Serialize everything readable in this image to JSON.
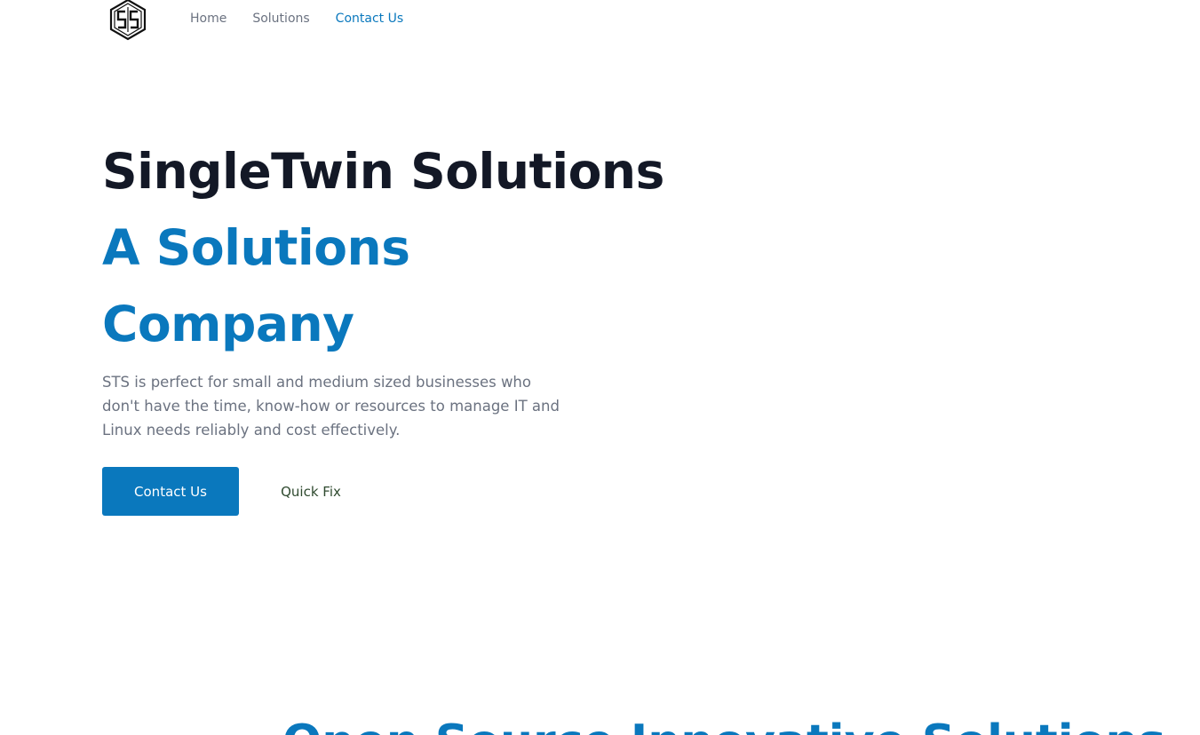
{
  "nav": {
    "logo_alt": "STS",
    "links": [
      {
        "label": "Home",
        "active": false
      },
      {
        "label": "Solutions",
        "active": false
      },
      {
        "label": "Contact Us",
        "active": true
      }
    ]
  },
  "hero": {
    "title_line1": "SingleTwin Solutions",
    "title_line2": "A Solutions Company",
    "description": "STS is perfect for small and medium sized businesses who don't have the time, know-how or resources to manage IT and Linux needs reliably and cost effectively.",
    "primary_button": "Contact Us",
    "secondary_button": "Quick Fix"
  },
  "next_section": {
    "heading": "Open Source Innovative Solutions"
  },
  "colors": {
    "accent": "#0a78bd",
    "heading_dark": "#131826",
    "muted_text": "#6b7280"
  }
}
